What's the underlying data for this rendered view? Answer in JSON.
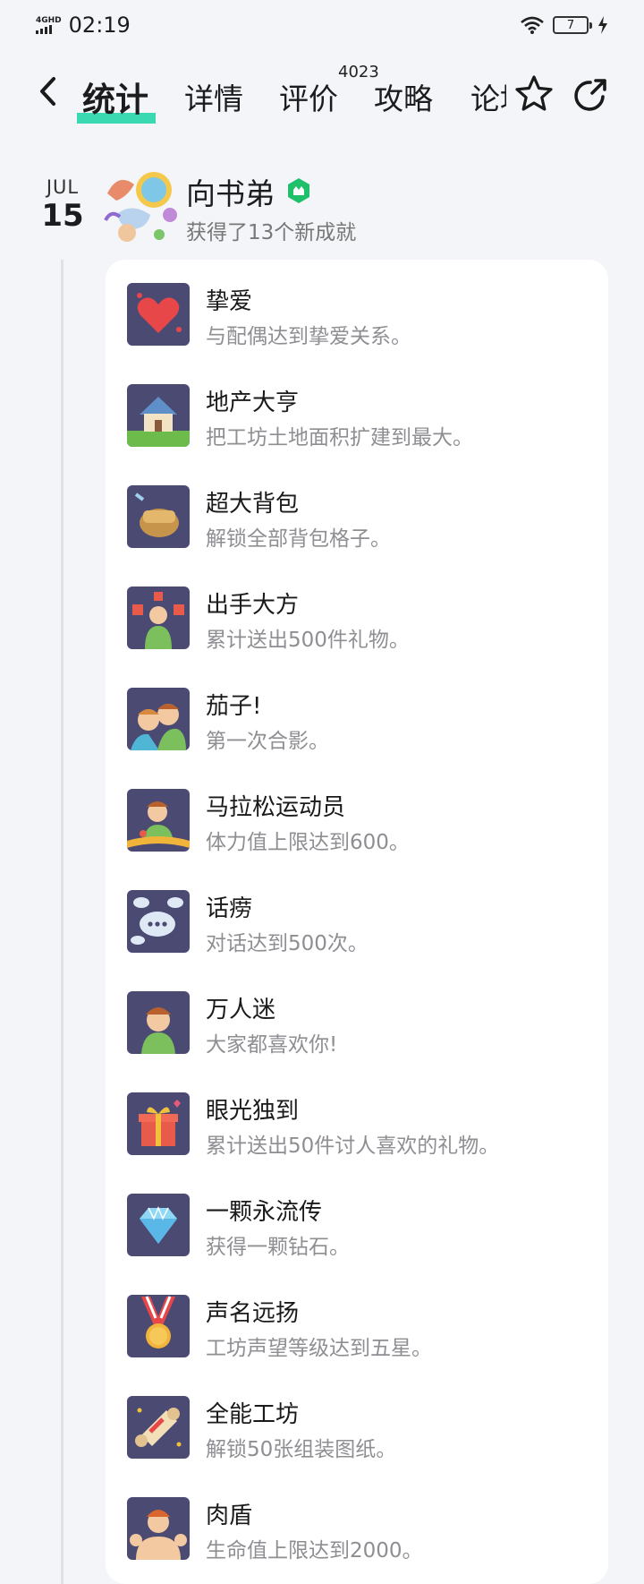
{
  "status": {
    "network": "4GHD",
    "time": "02:19",
    "battery": "7"
  },
  "tabs": [
    {
      "label": "统计"
    },
    {
      "label": "详情"
    },
    {
      "label": "评价"
    },
    {
      "label": "攻略"
    },
    {
      "label": "论坛"
    }
  ],
  "tab_badge": "4023",
  "feed": {
    "date_month": "JUL",
    "date_day": "15",
    "username": "向书弟",
    "subtitle": "获得了13个新成就"
  },
  "achievements": [
    {
      "title": "挚爱",
      "desc": "与配偶达到挚爱关系。",
      "icon": "heart-icon"
    },
    {
      "title": "地产大亨",
      "desc": "把工坊土地面积扩建到最大。",
      "icon": "house-icon"
    },
    {
      "title": "超大背包",
      "desc": "解锁全部背包格子。",
      "icon": "backpack-icon"
    },
    {
      "title": "出手大方",
      "desc": "累计送出500件礼物。",
      "icon": "gifts-icon"
    },
    {
      "title": "茄子!",
      "desc": "第一次合影。",
      "icon": "selfie-icon"
    },
    {
      "title": "马拉松运动员",
      "desc": "体力值上限达到600。",
      "icon": "runner-icon"
    },
    {
      "title": "话痨",
      "desc": "对话达到500次。",
      "icon": "chat-bubbles-icon"
    },
    {
      "title": "万人迷",
      "desc": "大家都喜欢你!",
      "icon": "charmer-icon"
    },
    {
      "title": "眼光独到",
      "desc": "累计送出50件讨人喜欢的礼物。",
      "icon": "gift-box-icon"
    },
    {
      "title": "一颗永流传",
      "desc": "获得一颗钻石。",
      "icon": "diamond-icon"
    },
    {
      "title": "声名远扬",
      "desc": "工坊声望等级达到五星。",
      "icon": "medal-icon"
    },
    {
      "title": "全能工坊",
      "desc": "解锁50张组装图纸。",
      "icon": "scroll-icon"
    },
    {
      "title": "肉盾",
      "desc": "生命值上限达到2000。",
      "icon": "strongman-icon"
    }
  ],
  "colors": {
    "accent": "#19d3a4",
    "icon_bg": "#4b4a72",
    "verified": "#20c06a"
  }
}
